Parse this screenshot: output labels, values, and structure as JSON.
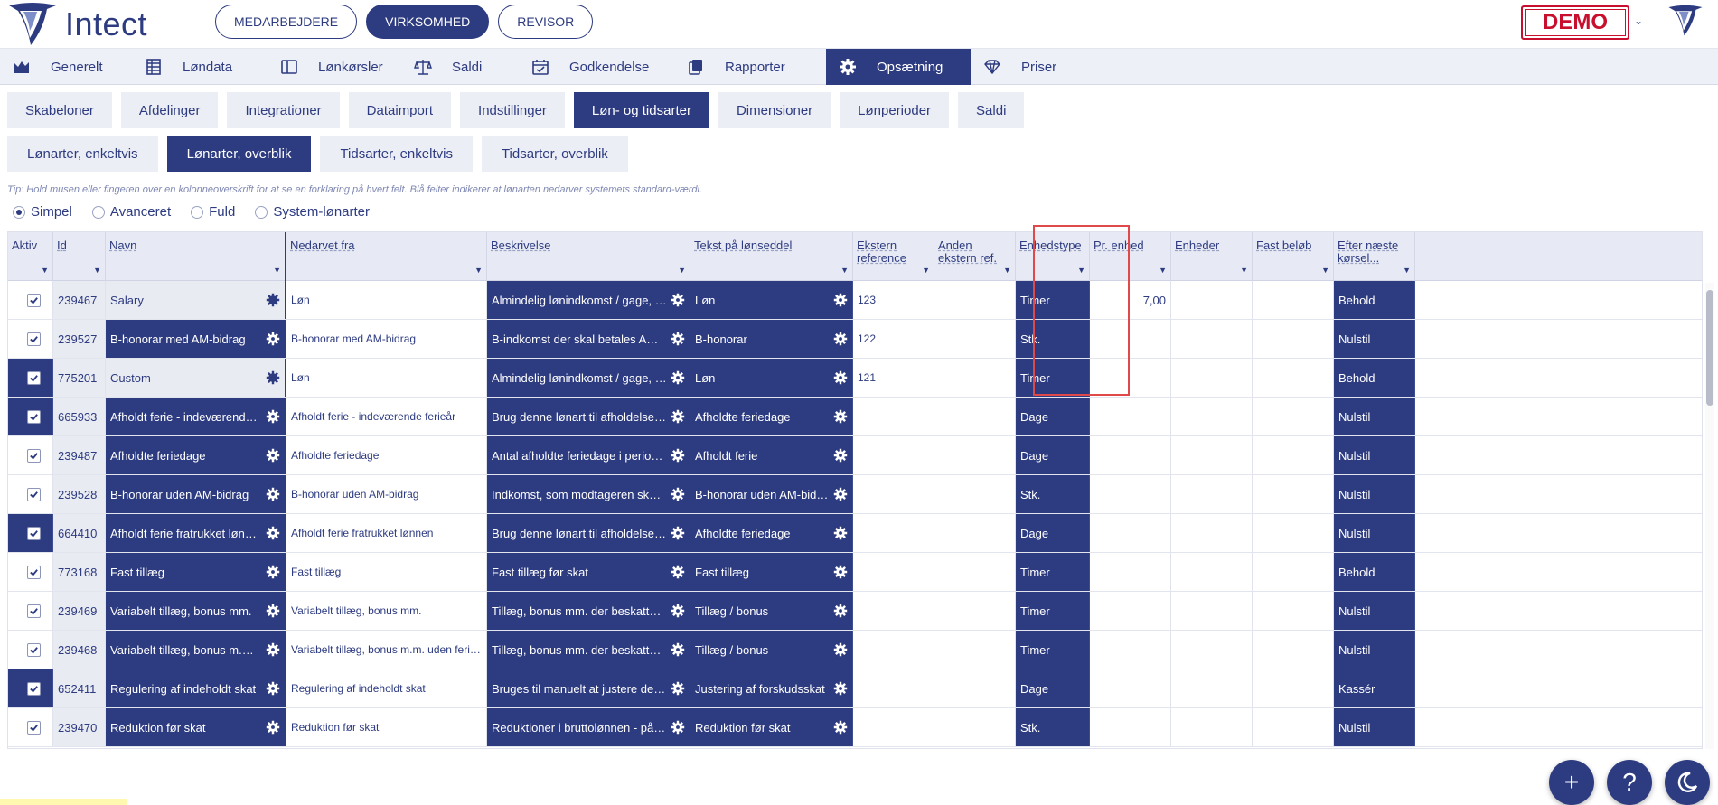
{
  "app": {
    "logo_text": "Intect",
    "demo_label": "DEMO"
  },
  "roles": [
    "MEDARBEJDERE",
    "VIRKSOMHED",
    "REVISOR"
  ],
  "roles_active": 1,
  "main_nav": [
    {
      "label": "Generelt",
      "icon": "chart-icon"
    },
    {
      "label": "Løndata",
      "icon": "grid-icon"
    },
    {
      "label": "Lønkørsler",
      "icon": "columns-icon"
    },
    {
      "label": "Saldi",
      "icon": "scale-icon"
    },
    {
      "label": "Godkendelse",
      "icon": "calendar-check-icon"
    },
    {
      "label": "Rapporter",
      "icon": "copy-icon"
    },
    {
      "label": "Opsætning",
      "icon": "gear-icon"
    },
    {
      "label": "Priser",
      "icon": "diamond-icon"
    }
  ],
  "main_nav_active": 6,
  "sub_nav1": [
    "Skabeloner",
    "Afdelinger",
    "Integrationer",
    "Dataimport",
    "Indstillinger",
    "Løn- og tidsarter",
    "Dimensioner",
    "Lønperioder",
    "Saldi"
  ],
  "sub_nav1_active": 5,
  "sub_nav2": [
    "Lønarter, enkeltvis",
    "Lønarter, overblik",
    "Tidsarter, enkeltvis",
    "Tidsarter, overblik"
  ],
  "sub_nav2_active": 1,
  "tip": "Tip: Hold musen eller fingeren over en kolonneoverskrift for at se en forklaring på hvert felt. Blå felter indikerer at lønarten nedarver systemets standard-værdi.",
  "view_modes": [
    "Simpel",
    "Avanceret",
    "Fuld",
    "System-lønarter"
  ],
  "view_mode_selected": 0,
  "columns": [
    "Aktiv",
    "Id",
    "Navn",
    "Nedarvet fra",
    "Beskrivelse",
    "Tekst på lønseddel",
    "Ekstern reference",
    "Anden ekstern ref.",
    "Enhedstype",
    "Pr. enhed",
    "Enheder",
    "Fast beløb",
    "Efter næste kørsel..."
  ],
  "rows": [
    {
      "aktiv_dark": false,
      "id": "239467",
      "navn": "Salary",
      "navn_dark": false,
      "nedarvet": "Løn",
      "beskrivelse": "Almindelig lønindkomst / gage, både fa...",
      "tekst": "Løn",
      "ekstern": "123",
      "enhedstype": "Timer",
      "pr_enhed": "7,00",
      "efter": "Behold"
    },
    {
      "aktiv_dark": false,
      "id": "239527",
      "navn": "B-honorar med AM-bidrag",
      "navn_dark": true,
      "nedarvet": "B-honorar med AM-bidrag",
      "beskrivelse": "B-indkomst der skal betales AM-bidrag ...",
      "tekst": "B-honorar",
      "ekstern": "122",
      "enhedstype": "Stk.",
      "pr_enhed": "",
      "efter": "Nulstil"
    },
    {
      "aktiv_dark": true,
      "id": "775201",
      "navn": "Custom",
      "navn_dark": false,
      "nedarvet": "Løn",
      "beskrivelse": "Almindelig lønindkomst / gage, både fa...",
      "tekst": "Løn",
      "ekstern": "121",
      "enhedstype": "Timer",
      "pr_enhed": "",
      "efter": "Behold"
    },
    {
      "aktiv_dark": true,
      "id": "665933",
      "navn": "Afholdt ferie - indeværende ferieår",
      "navn_dark": true,
      "nedarvet": "Afholdt ferie - indeværende ferieår",
      "beskrivelse": "Brug denne lønart til afholdelse af restf...",
      "tekst": "Afholdte feriedage",
      "ekstern": "",
      "enhedstype": "Dage",
      "pr_enhed": "",
      "efter": "Nulstil"
    },
    {
      "aktiv_dark": false,
      "id": "239487",
      "navn": "Afholdte feriedage",
      "navn_dark": true,
      "nedarvet": "Afholdte feriedage",
      "beskrivelse": "Antal afholdte feriedage i perioden. An...",
      "tekst": "Afholdt ferie",
      "ekstern": "",
      "enhedstype": "Dage",
      "pr_enhed": "",
      "efter": "Nulstil"
    },
    {
      "aktiv_dark": false,
      "id": "239528",
      "navn": "B-honorar uden AM-bidrag",
      "navn_dark": true,
      "nedarvet": "B-honorar uden AM-bidrag",
      "beskrivelse": "Indkomst, som modtageren skal betale ...",
      "tekst": "B-honorar uden AM-bidrag",
      "ekstern": "",
      "enhedstype": "Stk.",
      "pr_enhed": "",
      "efter": "Nulstil"
    },
    {
      "aktiv_dark": true,
      "id": "664410",
      "navn": "Afholdt ferie fratrukket lønnen",
      "navn_dark": true,
      "nedarvet": "Afholdt ferie fratrukket lønnen",
      "beskrivelse": "Brug denne lønart til afholdelse af ferie...",
      "tekst": "Afholdte feriedage",
      "ekstern": "",
      "enhedstype": "Dage",
      "pr_enhed": "",
      "efter": "Nulstil"
    },
    {
      "aktiv_dark": false,
      "id": "773168",
      "navn": "Fast tillæg",
      "navn_dark": true,
      "nedarvet": "Fast tillæg",
      "beskrivelse": "Fast tillæg før skat",
      "tekst": "Fast tillæg",
      "ekstern": "",
      "enhedstype": "Timer",
      "pr_enhed": "",
      "efter": "Behold"
    },
    {
      "aktiv_dark": false,
      "id": "239469",
      "navn": "Variabelt tillæg, bonus mm.",
      "navn_dark": true,
      "nedarvet": "Variabelt tillæg, bonus mm.",
      "beskrivelse": "Tillæg, bonus mm. der beskattes som a...",
      "tekst": "Tillæg / bonus",
      "ekstern": "",
      "enhedstype": "Timer",
      "pr_enhed": "",
      "efter": "Nulstil"
    },
    {
      "aktiv_dark": false,
      "id": "239468",
      "navn": "Variabelt tillæg, bonus m.m. uden ...",
      "navn_dark": true,
      "nedarvet": "Variabelt tillæg, bonus m.m. uden ferieberet...",
      "beskrivelse": "Tillæg, bonus mm. der beskattes som a...",
      "tekst": "Tillæg / bonus",
      "ekstern": "",
      "enhedstype": "Timer",
      "pr_enhed": "",
      "efter": "Nulstil"
    },
    {
      "aktiv_dark": true,
      "id": "652411",
      "navn": "Regulering af indeholdt skat",
      "navn_dark": true,
      "nedarvet": "Regulering af indeholdt skat",
      "beskrivelse": "Bruges til manuelt at justere den indeh...",
      "tekst": "Justering af forskudsskat",
      "ekstern": "",
      "enhedstype": "Dage",
      "pr_enhed": "",
      "efter": "Kassér"
    },
    {
      "aktiv_dark": false,
      "id": "239470",
      "navn": "Reduktion før skat",
      "navn_dark": true,
      "nedarvet": "Reduktion før skat",
      "beskrivelse": "Reduktioner i bruttolønnen - påvirker i...",
      "tekst": "Reduktion før skat",
      "ekstern": "",
      "enhedstype": "Stk.",
      "pr_enhed": "",
      "efter": "Nulstil"
    }
  ],
  "fabs": [
    {
      "label": "+",
      "icon": "plus-icon"
    },
    {
      "label": "?",
      "icon": "help-icon"
    },
    {
      "label": "",
      "icon": "moon-icon"
    }
  ],
  "colors": {
    "primary": "#2d3b80",
    "demo_red": "#c8102e",
    "highlight": "#e0494a"
  }
}
